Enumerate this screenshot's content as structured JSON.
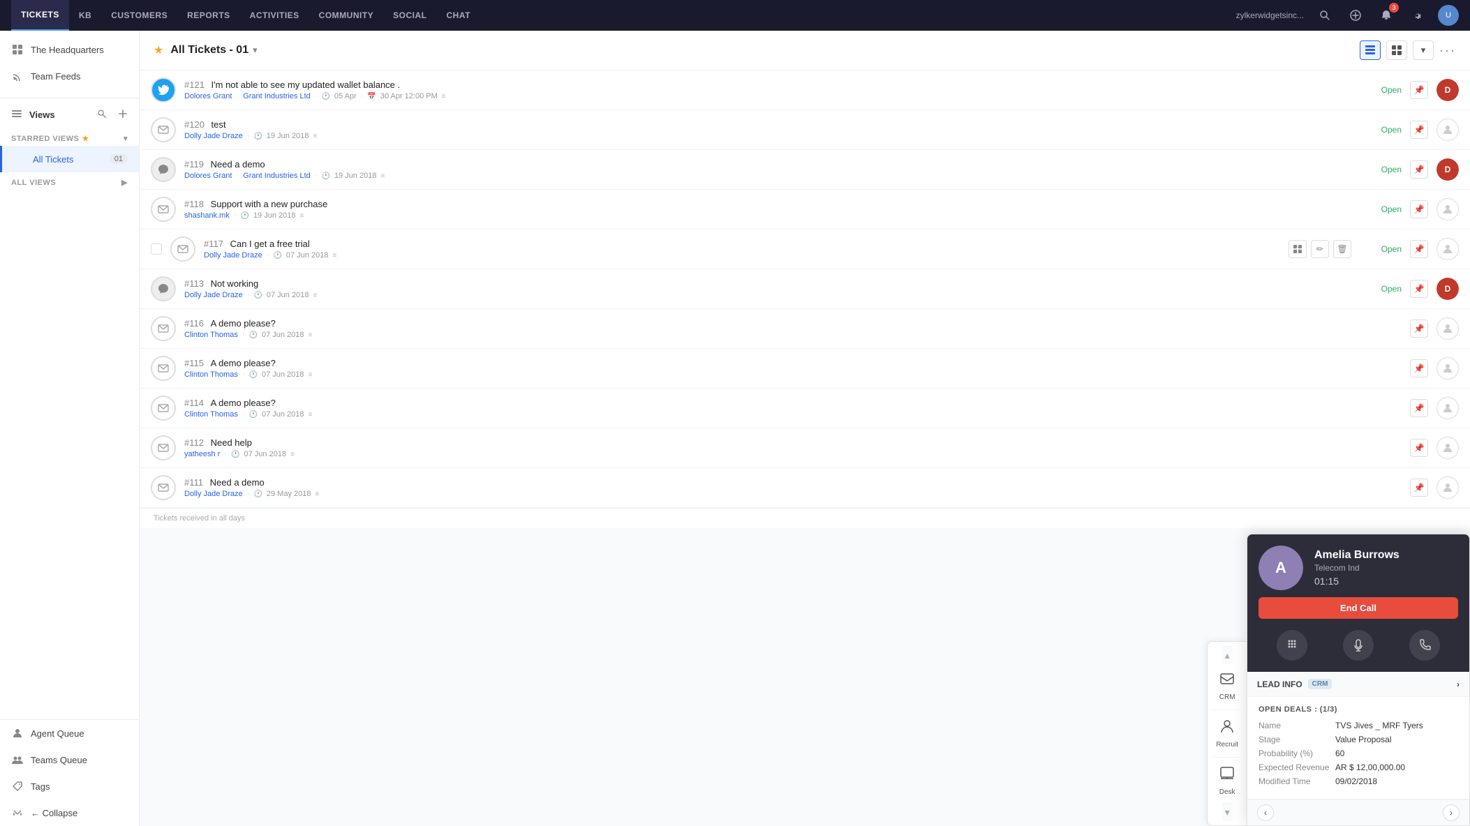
{
  "topNav": {
    "items": [
      {
        "id": "tickets",
        "label": "TICKETS",
        "active": true
      },
      {
        "id": "kb",
        "label": "KB",
        "active": false
      },
      {
        "id": "customers",
        "label": "CUSTOMERS",
        "active": false
      },
      {
        "id": "reports",
        "label": "REPORTS",
        "active": false
      },
      {
        "id": "activities",
        "label": "ACTIVITIES",
        "active": false
      },
      {
        "id": "community",
        "label": "COMMUNITY",
        "active": false
      },
      {
        "id": "social",
        "label": "SOCIAL",
        "active": false
      },
      {
        "id": "chat",
        "label": "CHAT",
        "active": false
      }
    ],
    "companyName": "zylkerwidgetsinc...",
    "notifCount": "3"
  },
  "sidebar": {
    "topSection": [
      {
        "id": "headquarters",
        "label": "The Headquarters",
        "icon": "grid"
      },
      {
        "id": "teamfeeds",
        "label": "Team Feeds",
        "icon": "rss"
      }
    ],
    "viewsLabel": "Views",
    "starredViews": {
      "label": "STARRED VIEWS",
      "items": [
        {
          "id": "alltickets",
          "label": "All Tickets",
          "count": "01",
          "active": true
        }
      ]
    },
    "allViews": {
      "label": "ALL VIEWS"
    },
    "bottomItems": [
      {
        "id": "agentqueue",
        "label": "Agent Queue",
        "icon": "person"
      },
      {
        "id": "teamsqueue",
        "label": "Teams Queue",
        "icon": "people"
      },
      {
        "id": "tags",
        "label": "Tags",
        "icon": "tag"
      }
    ],
    "collapseLabel": "Collapse"
  },
  "ticketsHeader": {
    "title": "All Tickets - 01",
    "starIcon": "★"
  },
  "tickets": [
    {
      "id": "121",
      "subject": "I'm not able to see my updated wallet balance .",
      "customer": "Dolores Grant",
      "company": "Grant Industries Ltd",
      "date1": "05 Apr",
      "date2": "30 Apr 12:00 PM",
      "status": "Open",
      "channel": "twitter",
      "hasAvatar": true,
      "avatarBg": "#c0392b"
    },
    {
      "id": "120",
      "subject": "test",
      "customer": "Dolly Jade Draze",
      "company": "",
      "date1": "19 Jun 2018",
      "date2": "",
      "status": "Open",
      "channel": "email",
      "hasAvatar": false
    },
    {
      "id": "119",
      "subject": "Need a demo",
      "customer": "Dolores Grant",
      "company": "Grant Industries Ltd",
      "date1": "19 Jun 2018",
      "date2": "",
      "status": "Open",
      "channel": "chat",
      "hasAvatar": true,
      "avatarBg": "#c0392b"
    },
    {
      "id": "118",
      "subject": "Support with a new purchase",
      "customer": "shashank.mk",
      "company": "",
      "date1": "19 Jun 2018",
      "date2": "",
      "status": "Open",
      "channel": "email",
      "hasAvatar": false
    },
    {
      "id": "117",
      "subject": "Can I get a free trial",
      "customer": "Dolly Jade Draze",
      "company": "",
      "date1": "07 Jun 2018",
      "date2": "",
      "status": "Open",
      "channel": "email",
      "hasAvatar": false,
      "showRowActions": true
    },
    {
      "id": "113",
      "subject": "Not working",
      "customer": "Dolly Jade Draze",
      "company": "",
      "date1": "07 Jun 2018",
      "date2": "",
      "status": "Open",
      "channel": "chat",
      "hasAvatar": true,
      "avatarBg": "#c0392b"
    },
    {
      "id": "116",
      "subject": "A demo please?",
      "customer": "Clinton Thomas",
      "company": "",
      "date1": "07 Jun 2018",
      "date2": "",
      "status": "",
      "channel": "email",
      "hasAvatar": false
    },
    {
      "id": "115",
      "subject": "A demo please?",
      "customer": "Clinton Thomas",
      "company": "",
      "date1": "07 Jun 2018",
      "date2": "",
      "status": "",
      "channel": "email",
      "hasAvatar": false
    },
    {
      "id": "114",
      "subject": "A demo please?",
      "customer": "Clinton Thomas",
      "company": "",
      "date1": "07 Jun 2018",
      "date2": "",
      "status": "",
      "channel": "email",
      "hasAvatar": false
    },
    {
      "id": "112",
      "subject": "Need help",
      "customer": "yatheesh r",
      "company": "",
      "date1": "07 Jun 2018",
      "date2": "",
      "status": "",
      "channel": "email",
      "hasAvatar": false
    },
    {
      "id": "111",
      "subject": "Need a demo",
      "customer": "Dolly Jade Draze",
      "company": "",
      "date1": "29 May 2018",
      "date2": "",
      "status": "",
      "channel": "email",
      "hasAvatar": false
    }
  ],
  "ticketsFooter": "Tickets received in all days",
  "callWidget": {
    "callerName": "Amelia Burrows",
    "callerCompany": "Telecom Ind",
    "timer": "01:15",
    "endCallLabel": "End Call"
  },
  "crmPanel": {
    "headerLabel": "LEAD INFO",
    "crmTag": "CRM",
    "openDeals": {
      "title": "OPEN DEALS : (1/3)",
      "fields": [
        {
          "label": "Name",
          "value": "TVS Jives _ MRF Tyers"
        },
        {
          "label": "Stage",
          "value": "Value Proposal"
        },
        {
          "label": "Probability (%)",
          "value": "60"
        },
        {
          "label": "Expected Revenue",
          "value": "AR $ 12,00,000.00"
        },
        {
          "label": "Modified Time",
          "value": "09/02/2018"
        }
      ]
    }
  },
  "sideIcons": [
    {
      "id": "crm",
      "label": "CRM",
      "icon": "crm"
    },
    {
      "id": "recruit",
      "label": "Recruit",
      "icon": "recruit"
    },
    {
      "id": "desk",
      "label": "Desk",
      "icon": "desk"
    }
  ]
}
